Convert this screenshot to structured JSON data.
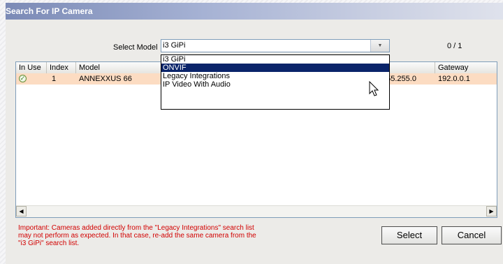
{
  "window": {
    "title": "Search For IP Camera"
  },
  "model": {
    "label": "Select Model",
    "selected": "i3 GiPi",
    "options": [
      "i3 GiPi",
      "ONVIF",
      "Legacy Integrations",
      "IP Video With Audio"
    ],
    "highlighted": "ONVIF"
  },
  "counter": "0 / 1",
  "table": {
    "columns": [
      "In Use",
      "Index",
      "Model",
      "k",
      "Gateway"
    ],
    "rows": [
      {
        "in_use": "check-icon",
        "index": "1",
        "model": "ANNEXXUS 66",
        "mask": "255.255.0",
        "gateway": "192.0.0.1"
      }
    ]
  },
  "warning": "Important: Cameras added directly from the \"Legacy Integrations\" search list\nmay not perform as expected. In that case, re-add the same camera from the\n\"i3 GiPi\" search list.",
  "buttons": {
    "select": "Select",
    "cancel": "Cancel"
  },
  "colors": {
    "row_highlight": "#fcdcc2",
    "selection": "#0a246a",
    "warning_text": "#d20000",
    "title_gradient_start": "#7b8ab6"
  }
}
